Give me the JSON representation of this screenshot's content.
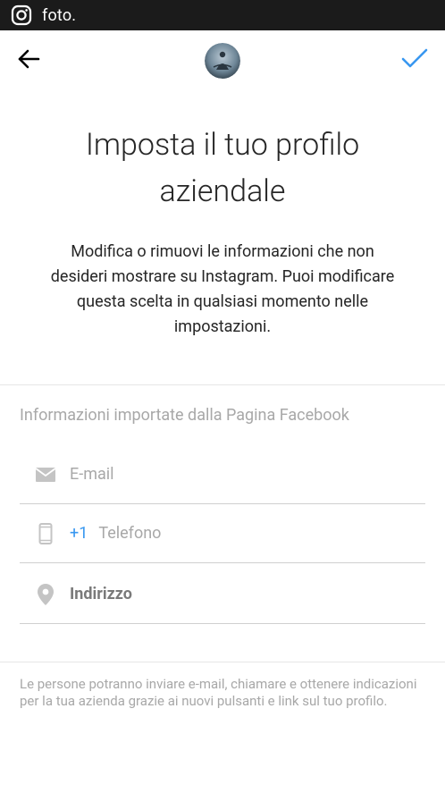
{
  "status_bar": {
    "app_icon": "instagram-icon",
    "title": "foto."
  },
  "top_bar": {
    "back_icon": "arrow-left-icon",
    "avatar": "profile-avatar",
    "confirm_icon": "checkmark-icon",
    "confirm_color": "#3897f0"
  },
  "header": {
    "title": "Imposta il tuo profilo aziendale",
    "description": "Modifica o rimuovi le informazioni che non desideri mostrare su Instagram. Puoi modificare questa scelta in qualsiasi momento nelle impostazioni."
  },
  "imported_section": {
    "title": "Informazioni importate dalla Pagina Facebook",
    "email": {
      "icon": "envelope-icon",
      "placeholder": "E-mail"
    },
    "phone": {
      "icon": "phone-icon",
      "country_code": "+1",
      "placeholder": "Telefono"
    },
    "address": {
      "icon": "location-pin-icon",
      "value": "Indirizzo"
    }
  },
  "footnote": "Le persone potranno inviare e-mail, chiamare e ottenere indicazioni per la tua azienda grazie ai nuovi pulsanti e link sul tuo profilo."
}
